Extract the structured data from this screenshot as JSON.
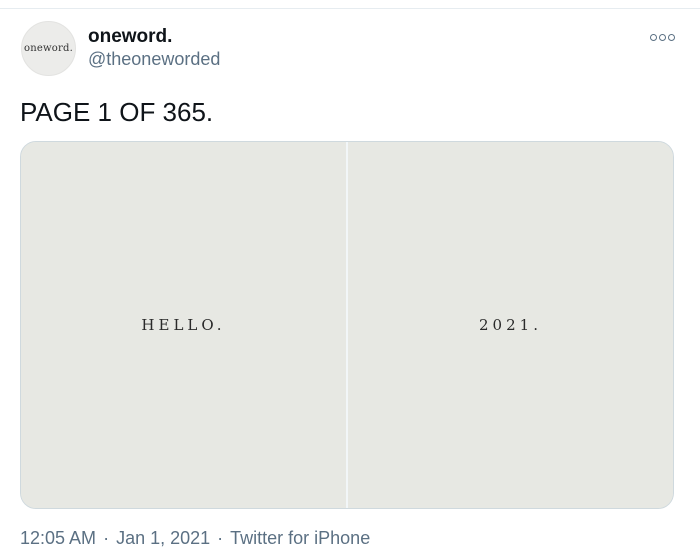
{
  "user": {
    "display_name": "oneword.",
    "handle": "@theoneworded",
    "avatar_text": "oneword."
  },
  "tweet": {
    "text": "PAGE 1 OF 365."
  },
  "media": {
    "left_text": "HELLO.",
    "right_text": "2021."
  },
  "meta": {
    "time": "12:05 AM",
    "separator": "·",
    "date": "Jan 1, 2021",
    "source": "Twitter for iPhone"
  },
  "icons": {
    "more": "more-options-icon"
  },
  "colors": {
    "text_primary": "#0f1419",
    "text_secondary": "#5b7083",
    "border": "#cfd9de"
  }
}
